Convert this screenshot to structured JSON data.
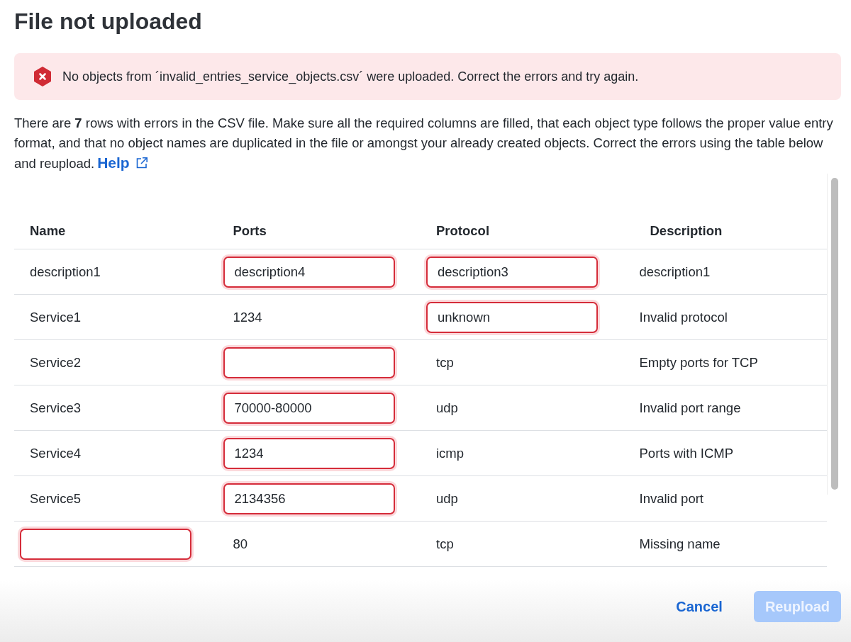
{
  "title": "File not uploaded",
  "alert": {
    "kind": "error",
    "message": "No objects from ´invalid_entries_service_objects.csv´ were uploaded. Correct the errors and try again."
  },
  "intro": {
    "text": "There are **7** rows with errors in the CSV file. Make sure all the required columns are filled, that each object type follows the proper value entry format, and that no object names are duplicated in the file or amongst your already created objects. Correct the errors using the table below and reupload.",
    "link": "Help"
  },
  "table": {
    "columns": [
      "Name",
      "Ports",
      "Protocol",
      "Description"
    ],
    "rows": [
      [
        {
          "value": "description1",
          "error": false
        },
        {
          "value": "description4",
          "error": true
        },
        {
          "value": "description3",
          "error": true
        },
        {
          "value": "description1",
          "error": false
        }
      ],
      [
        {
          "value": "Service1",
          "error": false
        },
        {
          "value": "1234",
          "error": false
        },
        {
          "value": "unknown",
          "error": true
        },
        {
          "value": "Invalid protocol",
          "error": false
        }
      ],
      [
        {
          "value": "Service2",
          "error": false
        },
        {
          "error": true
        },
        {
          "value": "tcp",
          "error": false
        },
        {
          "value": "Empty ports for TCP",
          "error": false
        }
      ],
      [
        {
          "value": "Service3",
          "error": false
        },
        {
          "value": "70000-80000",
          "error": true
        },
        {
          "value": "udp",
          "error": false
        },
        {
          "value": "Invalid port range",
          "error": false
        }
      ],
      [
        {
          "value": "Service4",
          "error": false
        },
        {
          "value": "1234",
          "error": true
        },
        {
          "value": "icmp",
          "error": false
        },
        {
          "value": "Ports with ICMP",
          "error": false
        }
      ],
      [
        {
          "value": "Service5",
          "error": false
        },
        {
          "value": "2134356",
          "error": true
        },
        {
          "value": "udp",
          "error": false
        },
        {
          "value": "Invalid port",
          "error": false
        }
      ],
      [
        {
          "error": true
        },
        {
          "value": "80",
          "error": false
        },
        {
          "value": "tcp",
          "error": false
        },
        {
          "value": "Missing name",
          "error": false
        }
      ]
    ]
  },
  "buttons": [
    {
      "kind": "link",
      "label": "Cancel",
      "disabled": false
    },
    {
      "kind": "primary",
      "label": "Reupload",
      "disabled": true
    }
  ]
}
